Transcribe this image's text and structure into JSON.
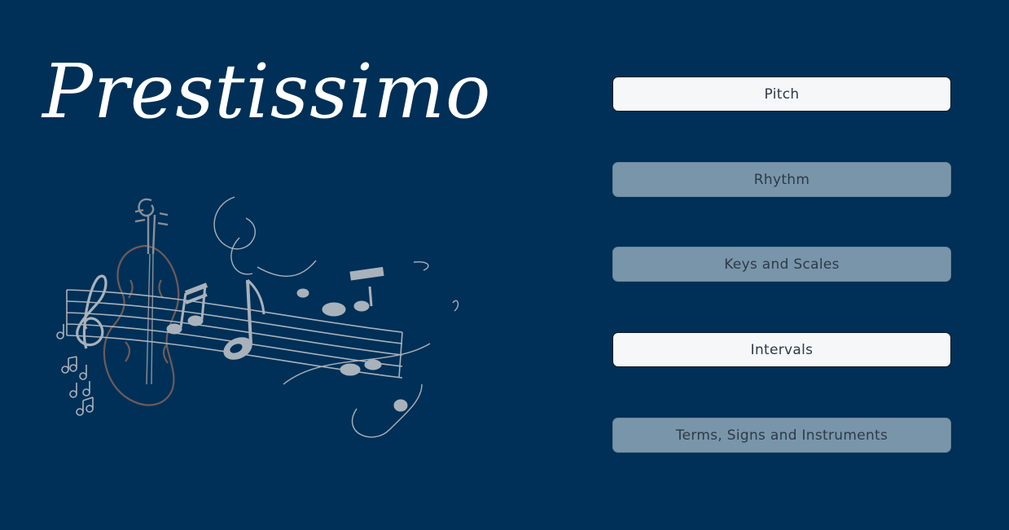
{
  "app": {
    "title": "Prestissimo"
  },
  "menu": {
    "items": [
      {
        "label": "Pitch",
        "state": "enabled"
      },
      {
        "label": "Rhythm",
        "state": "disabled"
      },
      {
        "label": "Keys and Scales",
        "state": "disabled"
      },
      {
        "label": "Intervals",
        "state": "enabled"
      },
      {
        "label": "Terms, Signs and Instruments",
        "state": "disabled"
      }
    ]
  },
  "colors": {
    "background": "#003057",
    "title": "#ffffff",
    "button_enabled": "#f6f7f9",
    "button_disabled": "#7995aa",
    "button_text": "#2d3a47",
    "illustration_ink": "#a9b2bb",
    "violin_ink": "#6e5a5a"
  },
  "icons": {
    "illustration": "violin-with-music-staff-and-notes-icon"
  }
}
